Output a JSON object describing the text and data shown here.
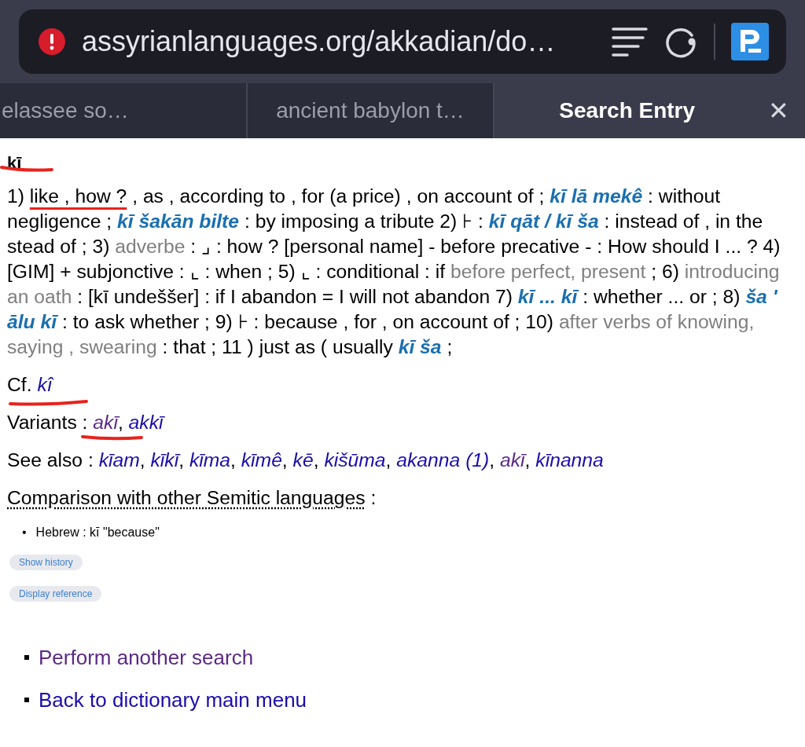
{
  "address_bar": {
    "warning": true,
    "url": "assyrianlanguages.org/akkadian/do…"
  },
  "tabs": [
    {
      "label": "elassee so…",
      "selected": false
    },
    {
      "label": "ancient babylon t…",
      "selected": false
    },
    {
      "label": "Search Entry",
      "selected": true
    }
  ],
  "close_tab": "✕",
  "entry": {
    "headword": "kī",
    "definition": [
      {
        "kind": "plain",
        "text": "1) "
      },
      {
        "kind": "annotated",
        "text": "like , how ?"
      },
      {
        "kind": "plain",
        "text": " , as , according to , for (a price) , on account of ; "
      },
      {
        "kind": "term",
        "text": "kī lā mekê"
      },
      {
        "kind": "plain",
        "text": " : without negligence ; "
      },
      {
        "kind": "term",
        "text": "kī šakān bilte"
      },
      {
        "kind": "plain",
        "text": " : by imposing a tribute 2) ⊦ : "
      },
      {
        "kind": "term",
        "text": "kī qāt / kī ša"
      },
      {
        "kind": "plain",
        "text": " : instead of , in the stead of ; 3) "
      },
      {
        "kind": "note",
        "text": "adverbe"
      },
      {
        "kind": "plain",
        "text": " : ⌟ : how ? [personal name] - before precative - : How should I ... ? 4) [GIM] + subjonctive : ⌞ : when ; 5) ⌞ : conditional : if "
      },
      {
        "kind": "note",
        "text": "before perfect, present"
      },
      {
        "kind": "plain",
        "text": " ; 6) "
      },
      {
        "kind": "note",
        "text": "introducing an oath"
      },
      {
        "kind": "plain",
        "text": " : [kī undeššer] : if I abandon = I will not abandon 7) "
      },
      {
        "kind": "term",
        "text": "kī ... kī"
      },
      {
        "kind": "plain",
        "text": " : whether ... or ; 8) "
      },
      {
        "kind": "term",
        "text": "ša ' ālu kī"
      },
      {
        "kind": "plain",
        "text": " : to ask whether ; 9) ⊦ : because , for , on account of ; 10) "
      },
      {
        "kind": "note",
        "text": "after verbs of knowing, saying , swearing"
      },
      {
        "kind": "plain",
        "text": " : that ; 11 ) just as ( usually "
      },
      {
        "kind": "term",
        "text": "kī ša"
      },
      {
        "kind": "plain",
        "text": " ;"
      }
    ],
    "cf": {
      "label": "Cf.",
      "links": [
        {
          "text": "kî",
          "visited": false
        }
      ]
    },
    "variants": {
      "label": "Variants",
      "colon": " : ",
      "links": [
        {
          "text": "akī",
          "visited": true
        },
        {
          "text": "akkī",
          "visited": false
        }
      ]
    },
    "see_also": {
      "label": "See also : ",
      "links": [
        {
          "text": "kīam",
          "visited": false
        },
        {
          "text": "kīkī",
          "visited": false
        },
        {
          "text": "kīma",
          "visited": false
        },
        {
          "text": "kīmê",
          "visited": false
        },
        {
          "text": "kē",
          "visited": false
        },
        {
          "text": "kišūma",
          "visited": false
        },
        {
          "text": "akanna (1)",
          "visited": false
        },
        {
          "text": "akī",
          "visited": true
        },
        {
          "text": "kīnanna",
          "visited": false
        }
      ]
    },
    "separator": ", ",
    "comparison": {
      "heading": "Comparison with other Semitic languages",
      "colon": " :",
      "bullet": "•",
      "items": [
        "Hebrew : kī \"because\""
      ]
    },
    "buttons": [
      "Show history",
      "Display reference"
    ]
  },
  "footer_links": [
    {
      "text": "Perform another search",
      "visited": true
    },
    {
      "text": "Back to dictionary main menu",
      "visited": false
    }
  ]
}
